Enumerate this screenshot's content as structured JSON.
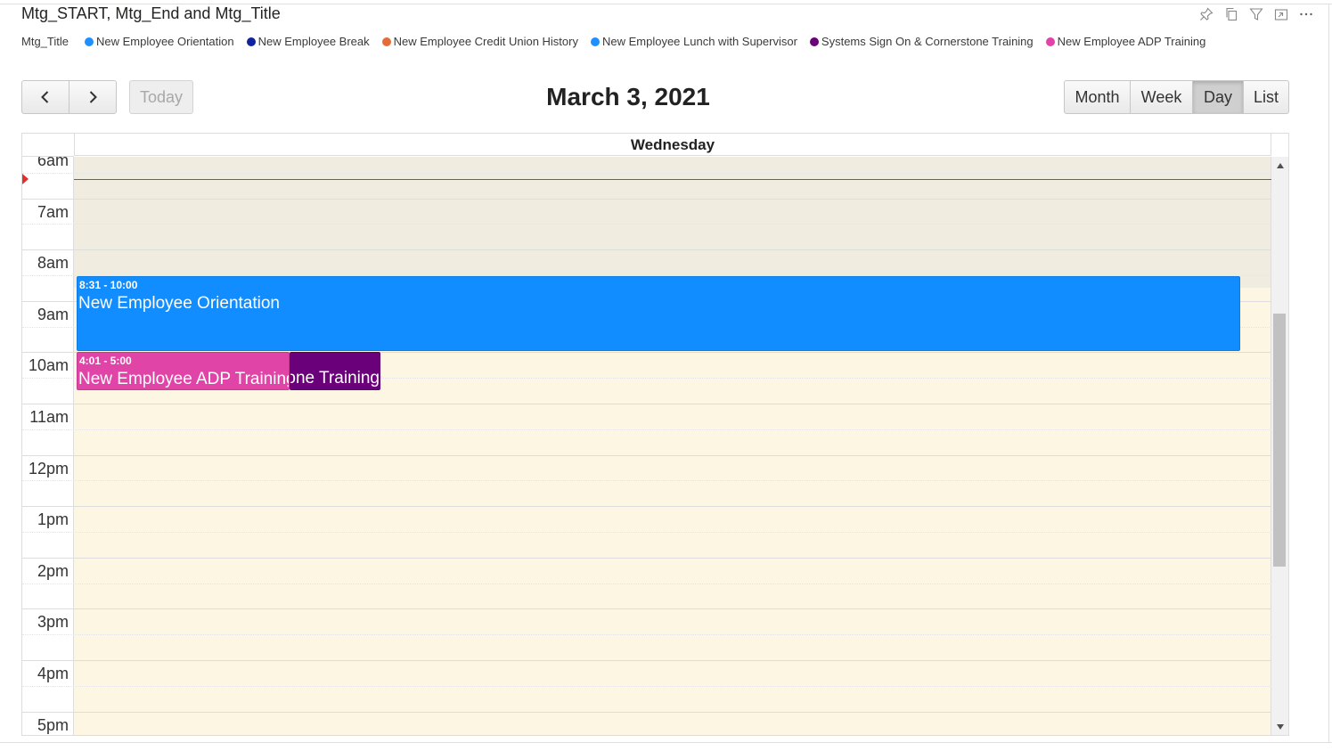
{
  "visual": {
    "title": "Mtg_START, Mtg_End and Mtg_Title",
    "header_icons": [
      "pin-icon",
      "copy-icon",
      "filter-icon",
      "focus-mode-icon",
      "more-options-icon"
    ]
  },
  "legend": {
    "title": "Mtg_Title",
    "items": [
      {
        "label": "New Employee Orientation",
        "color": "#1e90ff"
      },
      {
        "label": "New Employee Break",
        "color": "#12239e"
      },
      {
        "label": "New Employee Credit Union History",
        "color": "#e66c37"
      },
      {
        "label": "New Employee Lunch with Supervisor",
        "color": "#1e90ff"
      },
      {
        "label": "Systems Sign On & Cornerstone Training",
        "color": "#6b007b"
      },
      {
        "label": "New Employee ADP Training",
        "color": "#e044a7"
      }
    ]
  },
  "toolbar": {
    "prev_icon": "chevron-left-icon",
    "next_icon": "chevron-right-icon",
    "today_label": "Today",
    "title": "March 3, 2021",
    "views": {
      "month": "Month",
      "week": "Week",
      "day": "Day",
      "list": "List"
    },
    "active_view": "Day"
  },
  "calendar": {
    "day_header": "Wednesday",
    "time_labels": [
      "6am",
      "7am",
      "8am",
      "9am",
      "10am",
      "11am",
      "12pm",
      "1pm",
      "2pm",
      "3pm",
      "4pm",
      "5pm"
    ],
    "events": [
      {
        "id": "orientation",
        "time": "8:31 - 10:00",
        "title": "New Employee Orientation",
        "color": "#118dff"
      },
      {
        "id": "systems",
        "time": "",
        "title": "Systems Sign On & Cornerstone Training",
        "color": "#6b007b"
      },
      {
        "id": "adp",
        "time": "4:01 - 5:00",
        "title": "New Employee ADP Training",
        "color": "#e044a7"
      }
    ]
  }
}
